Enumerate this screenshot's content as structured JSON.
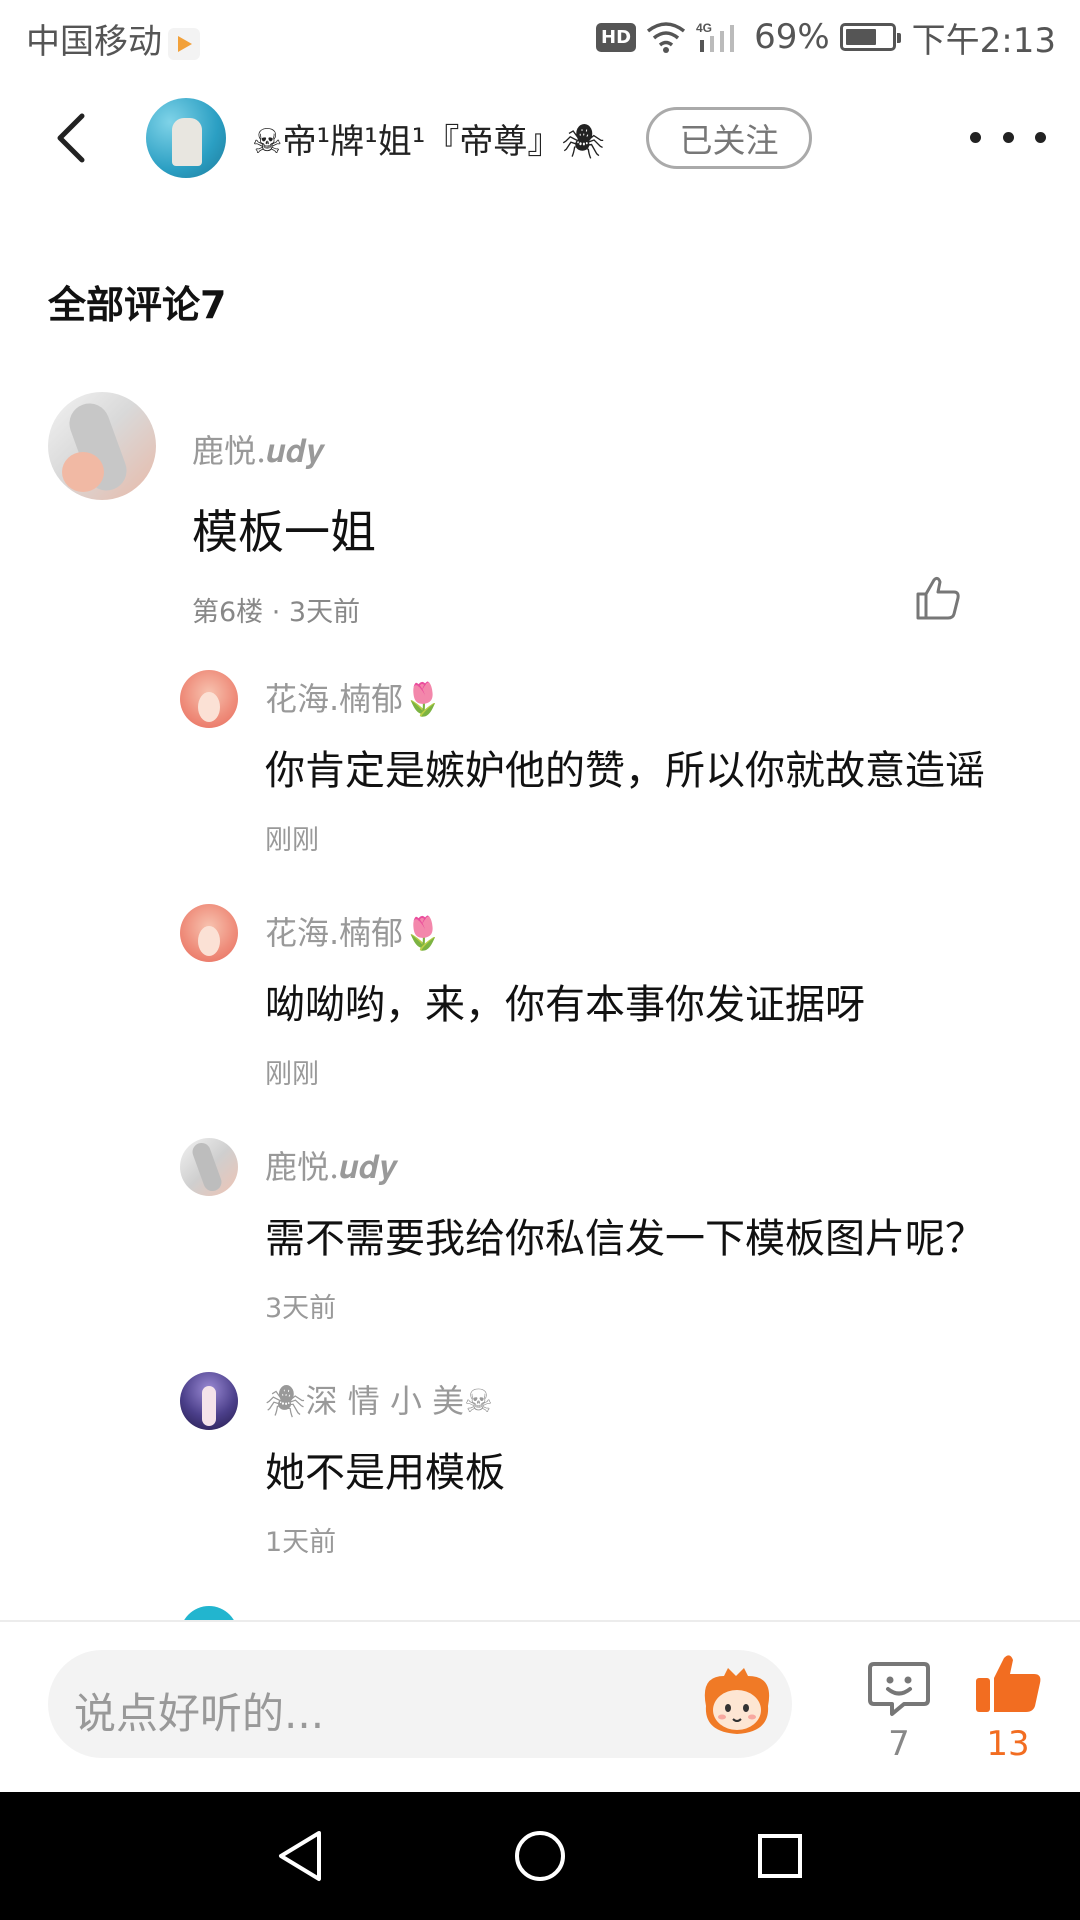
{
  "status_bar": {
    "carrier": "中国移动",
    "hd": "HD",
    "network": "4G",
    "battery": "69%",
    "time": "下午2:13"
  },
  "header": {
    "author_name": "☠帝¹牌¹姐¹『帝尊』🕷",
    "follow_label": "已关注"
  },
  "comments_section": {
    "title": "全部评论7"
  },
  "main_comment": {
    "user": "鹿悦.𝒖𝒅𝒚",
    "text": "模板一姐",
    "meta": "第6楼 · 3天前"
  },
  "replies": [
    {
      "user": "花海.楠郁🌷",
      "text": "你肯定是嫉妒他的赞，所以你就故意造谣",
      "time": "刚刚"
    },
    {
      "user": "花海.楠郁🌷",
      "text": "呦呦哟，来，你有本事你发证据呀",
      "time": "刚刚"
    },
    {
      "user": "鹿悦.𝒖𝒅𝒚",
      "text": "需不需要我给你私信发一下模板图片呢？",
      "time": "3天前"
    },
    {
      "user": "🕷深 情 小 美☠",
      "text": "她不是用模板",
      "time": "1天前"
    }
  ],
  "comment_bar": {
    "placeholder": "说点好听的...",
    "comment_count": "7",
    "like_count": "13"
  },
  "colors": {
    "accent_orange": "#f26d21",
    "muted_text": "#999999"
  },
  "icons": [
    "back-icon",
    "more-icon",
    "thumb-up-icon",
    "comment-icon",
    "thumb-up-filled-icon",
    "emoji-mascot-icon",
    "wifi-icon",
    "signal-icon",
    "battery-icon",
    "nav-back-icon",
    "nav-home-icon",
    "nav-recents-icon"
  ]
}
